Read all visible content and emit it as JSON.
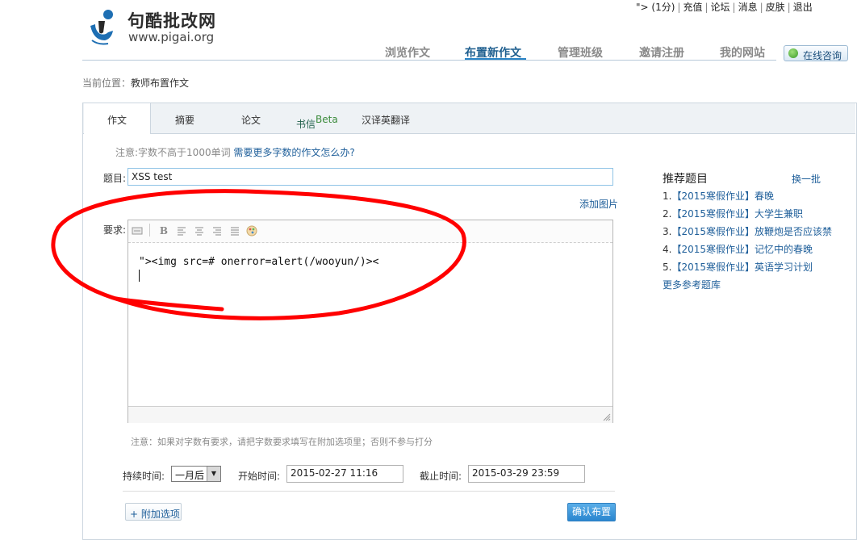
{
  "header": {
    "logo_name": "句酷批改网",
    "logo_url": "www.pigai.org",
    "top_links": [
      "\"> (1分)",
      "充值",
      "论坛",
      "消息",
      "皮肤",
      "退出"
    ],
    "nav": [
      "浏览作文",
      "布置新作文",
      "管理班级",
      "邀请注册",
      "我的网站"
    ],
    "online_consult": "在线咨询"
  },
  "breadcrumb": {
    "prefix": "当前位置：",
    "current": "教师布置作文"
  },
  "tabs": [
    {
      "label": "作文"
    },
    {
      "label": "摘要"
    },
    {
      "label": "论文"
    },
    {
      "label": "书信",
      "badge": "Beta"
    },
    {
      "label": "汉译英翻译"
    }
  ],
  "form": {
    "note": "注意:字数不高于1000单词",
    "note_link": "需要更多字数的作文怎么办?",
    "title_label": "题目:",
    "title_value": "XSS test",
    "add_image": "添加图片",
    "requirement_label": "要求:",
    "requirement_text": "\"><img src=# onerror=alert(/wooyun/)><",
    "word_note": "注意：如果对字数有要求，请把字数要求填写在附加选项里；否则不参与打分",
    "duration_label": "持续时间:",
    "duration_value": "一月后",
    "start_label": "开始时间:",
    "start_value": "2015-02-27 11:16",
    "end_label": "截止时间:",
    "end_value": "2015-03-29 23:59",
    "extra_options": "+ 附加选项",
    "confirm": "确认布置"
  },
  "recommend": {
    "title": "推荐题目",
    "refresh": "换一批",
    "items": [
      {
        "num": "1.",
        "text": "【2015寒假作业】春晚"
      },
      {
        "num": "2.",
        "text": "【2015寒假作业】大学生兼职"
      },
      {
        "num": "3.",
        "text": "【2015寒假作业】放鞭炮是否应该禁"
      },
      {
        "num": "4.",
        "text": "【2015寒假作业】记忆中的春晚"
      },
      {
        "num": "5.",
        "text": "【2015寒假作业】英语学习计划"
      }
    ],
    "more": "更多参考题库"
  },
  "colors": {
    "accent": "#2a84c6",
    "link": "#1f5f9a",
    "annotation": "#ff0000"
  }
}
